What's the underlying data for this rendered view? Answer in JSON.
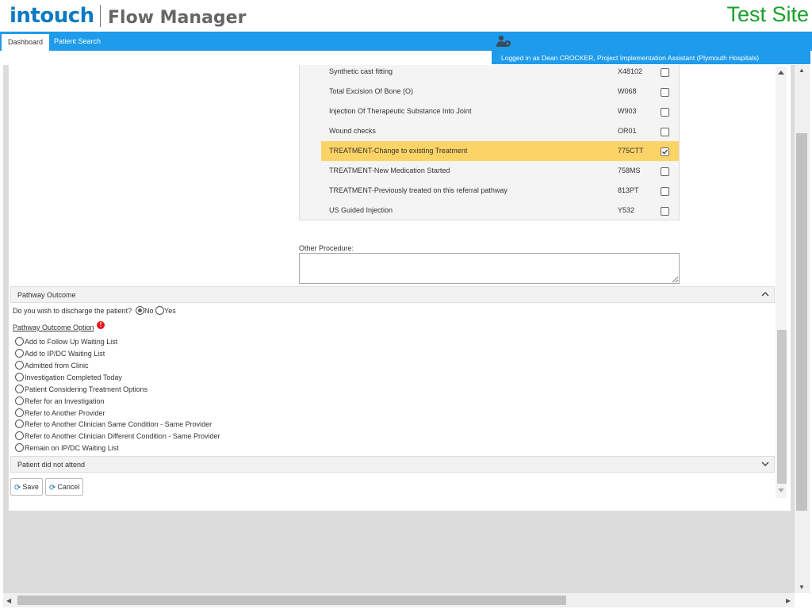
{
  "header": {
    "logo_word": "intouch",
    "product": "Flow Manager",
    "site_label": "Test Site"
  },
  "nav": {
    "tabs": [
      {
        "label": "Dashboard",
        "active": true
      },
      {
        "label": "Patient Search",
        "active": false
      }
    ],
    "user_icon": "user-settings-icon",
    "logged_in_text": "Logged in as Dean CROCKER, Project Implementation Assistant (Plymouth Hospitals)"
  },
  "procedures": [
    {
      "name": "Synthetic cast fitting",
      "code": "X48102",
      "checked": false
    },
    {
      "name": "Total Excision Of Bone (O)",
      "code": "W068",
      "checked": false
    },
    {
      "name": "Injection Of Therapeutic Substance Into Joint",
      "code": "W903",
      "checked": false
    },
    {
      "name": "Wound checks",
      "code": "OR01",
      "checked": false
    },
    {
      "name": "TREATMENT-Change to existing Treatment",
      "code": "775CTT",
      "checked": true
    },
    {
      "name": "TREATMENT-New Medication Started",
      "code": "758MS",
      "checked": false
    },
    {
      "name": "TREATMENT-Previously treated on this referral pathway",
      "code": "813PT",
      "checked": false
    },
    {
      "name": "US Guided Injection",
      "code": "Y532",
      "checked": false
    }
  ],
  "other_procedure": {
    "label": "Other Procedure:",
    "value": ""
  },
  "pathway_outcome": {
    "section_title": "Pathway Outcome",
    "discharge_question": "Do you wish to discharge the patient?",
    "discharge_options": [
      "No",
      "Yes"
    ],
    "discharge_selected": "No",
    "option_label": "Pathway Outcome Option",
    "required_icon": "!",
    "options": [
      "Add to Follow Up Waiting List",
      "Add to IP/DC Waiting List",
      "Admitted from Clinic",
      "Investigation Completed Today",
      "Patient Considering Treatment Options",
      "Refer for an Investigation",
      "Refer to Another Provider",
      "Refer to Another Clinician Same Condition - Same Provider",
      "Refer to Another Clinician Different Condition - Same Provider",
      "Remain on IP/DC Waiting List"
    ]
  },
  "dna_section": {
    "title": "Patient did not attend"
  },
  "buttons": {
    "save": "Save",
    "cancel": "Cancel"
  }
}
